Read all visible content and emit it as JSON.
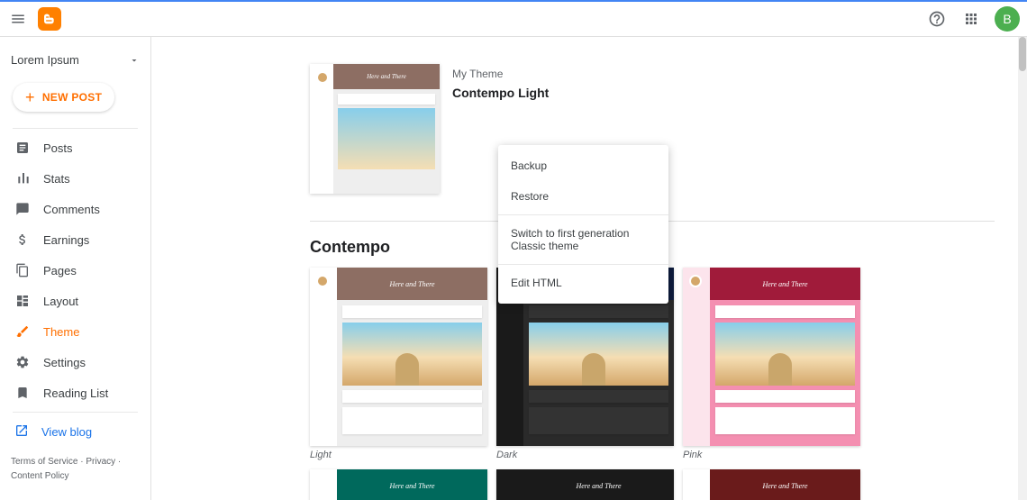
{
  "topbar": {
    "avatar_initial": "B"
  },
  "blog": {
    "name": "Lorem Ipsum"
  },
  "new_post": {
    "label": "NEW POST"
  },
  "nav": {
    "posts": "Posts",
    "stats": "Stats",
    "comments": "Comments",
    "earnings": "Earnings",
    "pages": "Pages",
    "layout": "Layout",
    "theme": "Theme",
    "settings": "Settings",
    "reading_list": "Reading List",
    "view_blog": "View blog"
  },
  "footer": {
    "terms": "Terms of Service",
    "privacy": "Privacy",
    "content_policy": "Content Policy"
  },
  "my_theme": {
    "label": "My Theme",
    "name": "Contempo Light"
  },
  "dropdown": {
    "backup": "Backup",
    "restore": "Restore",
    "switch": "Switch to first generation Classic theme",
    "edit_html": "Edit HTML"
  },
  "section": {
    "title": "Contempo"
  },
  "thumbs": {
    "header_text": "Here and There",
    "light": "Light",
    "dark": "Dark",
    "pink": "Pink"
  }
}
